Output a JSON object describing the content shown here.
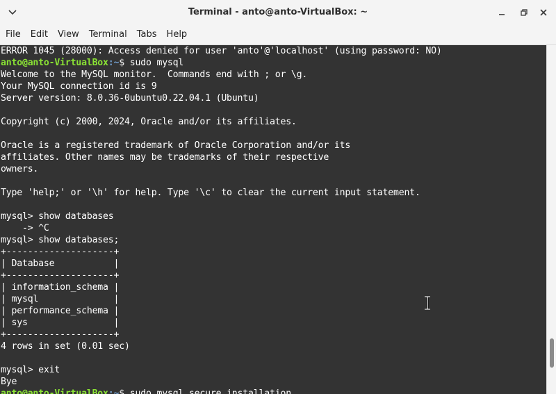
{
  "window": {
    "title": "Terminal - anto@anto-VirtualBox: ~",
    "menu_icon": "chevron-down-icon",
    "minimize_icon": "minimize-icon",
    "maximize_icon": "maximize-icon",
    "close_icon": "close-icon"
  },
  "menubar": {
    "items": [
      "File",
      "Edit",
      "View",
      "Terminal",
      "Tabs",
      "Help"
    ]
  },
  "terminal": {
    "prompt_user": "anto@anto-VirtualBox",
    "prompt_path": ":~",
    "lines": [
      {
        "text": "ERROR 1045 (28000): Access denied for user 'anto'@'localhost' (using password: NO)"
      },
      {
        "prompt": true,
        "cmd": "$ sudo mysql"
      },
      {
        "text": "Welcome to the MySQL monitor.  Commands end with ; or \\g."
      },
      {
        "text": "Your MySQL connection id is 9"
      },
      {
        "text": "Server version: 8.0.36-0ubuntu0.22.04.1 (Ubuntu)"
      },
      {
        "text": ""
      },
      {
        "text": "Copyright (c) 2000, 2024, Oracle and/or its affiliates."
      },
      {
        "text": ""
      },
      {
        "text": "Oracle is a registered trademark of Oracle Corporation and/or its"
      },
      {
        "text": "affiliates. Other names may be trademarks of their respective"
      },
      {
        "text": "owners."
      },
      {
        "text": ""
      },
      {
        "text": "Type 'help;' or '\\h' for help. Type '\\c' to clear the current input statement."
      },
      {
        "text": ""
      },
      {
        "text": "mysql> show databases"
      },
      {
        "text": "    -> ^C"
      },
      {
        "text": "mysql> show databases;"
      },
      {
        "text": "+--------------------+"
      },
      {
        "text": "| Database           |"
      },
      {
        "text": "+--------------------+"
      },
      {
        "text": "| information_schema |"
      },
      {
        "text": "| mysql              |"
      },
      {
        "text": "| performance_schema |"
      },
      {
        "text": "| sys                |"
      },
      {
        "text": "+--------------------+"
      },
      {
        "text": "4 rows in set (0.01 sec)"
      },
      {
        "text": ""
      },
      {
        "text": "mysql> exit"
      },
      {
        "text": "Bye"
      },
      {
        "prompt": true,
        "cmd": "$ sudo mysql_secure_installation"
      }
    ]
  },
  "colors": {
    "terminal_bg": "#333333",
    "prompt_user": "#8ae234",
    "prompt_path": "#729fcf",
    "text": "#ffffff"
  }
}
